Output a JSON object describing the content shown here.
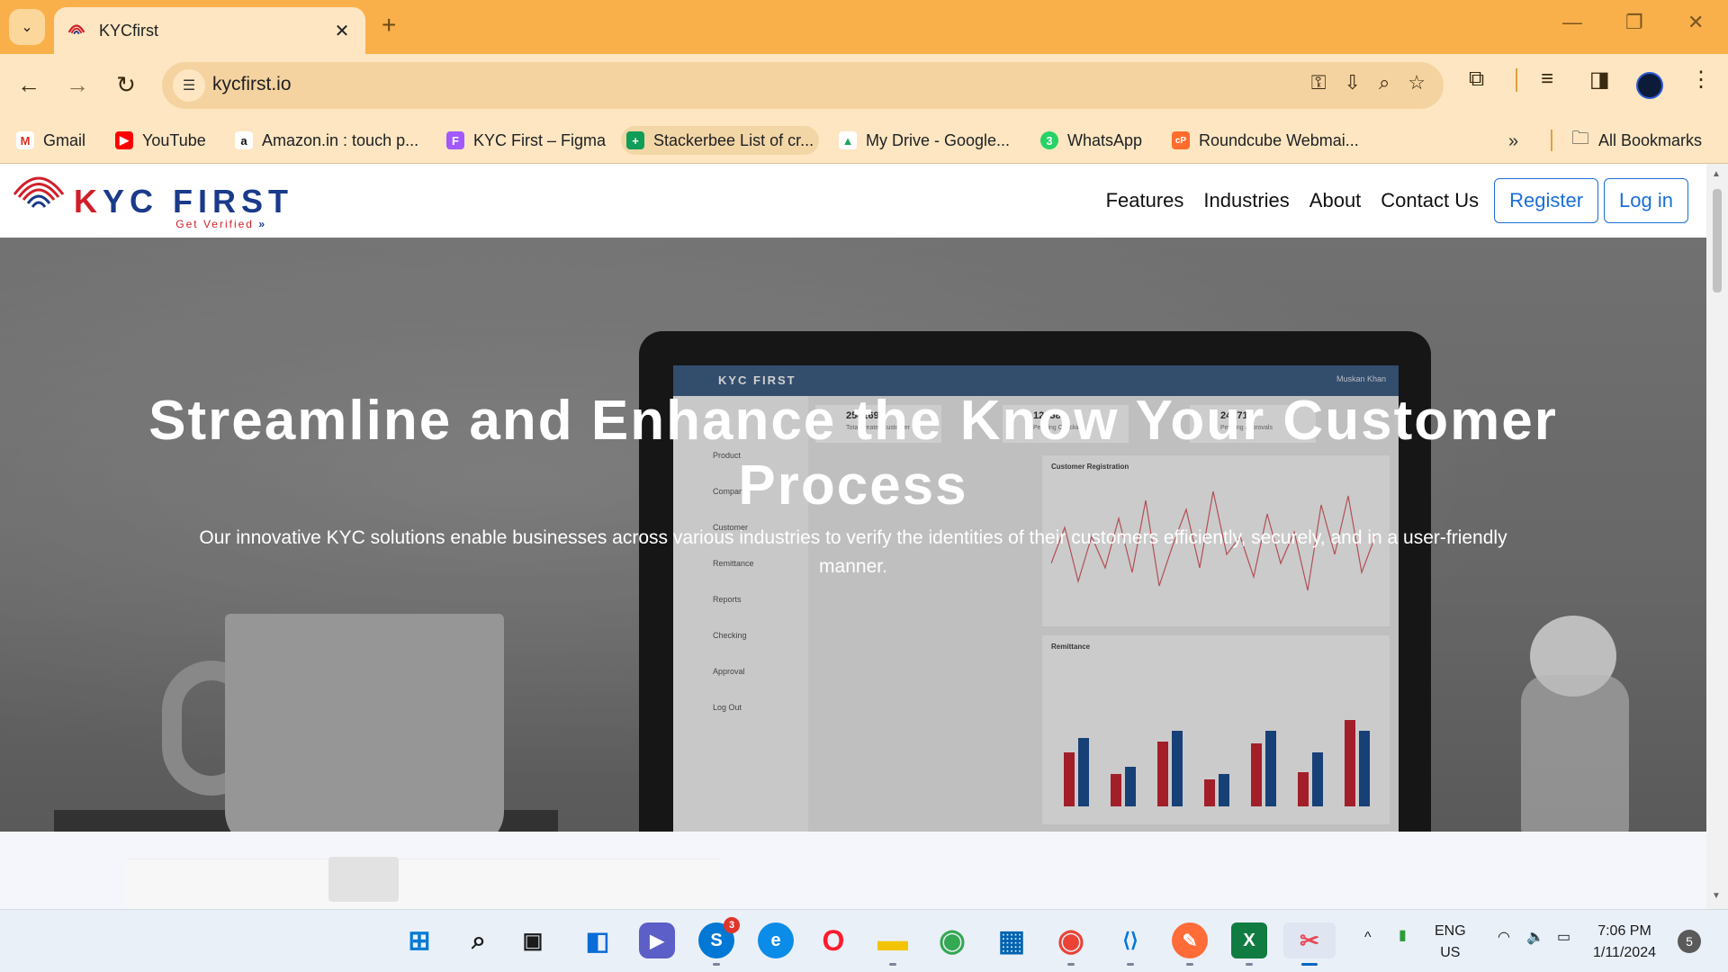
{
  "browser": {
    "tab": {
      "title": "KYCfirst",
      "close": "✕"
    },
    "new_tab": "+",
    "window_controls": {
      "minimize": "—",
      "maximize": "❐",
      "close": "✕"
    },
    "nav": {
      "back": "←",
      "forward": "→",
      "reload": "↻"
    },
    "url": "kycfirst.io",
    "bookmarks": [
      {
        "label": "Gmail",
        "icon": "gmail-icon",
        "color": "#d93025",
        "glyph": "M"
      },
      {
        "label": "YouTube",
        "icon": "youtube-icon",
        "color": "#ff0000",
        "glyph": "▶"
      },
      {
        "label": "Amazon.in : touch p...",
        "icon": "amazon-icon",
        "color": "#111111",
        "glyph": "a"
      },
      {
        "label": "KYC First – Figma",
        "icon": "figma-icon",
        "color": "#a259ff",
        "glyph": "F"
      },
      {
        "label": "Stackerbee List of cr...",
        "icon": "sheets-icon",
        "color": "#0f9d58",
        "glyph": "+"
      },
      {
        "label": "My Drive - Google...",
        "icon": "drive-icon",
        "color": "#1fa463",
        "glyph": "▲"
      },
      {
        "label": "WhatsApp",
        "icon": "whatsapp-icon",
        "color": "#25d366",
        "glyph": "3"
      },
      {
        "label": "Roundcube Webmai...",
        "icon": "cpanel-icon",
        "color": "#ff6c2c",
        "glyph": "cP"
      }
    ],
    "more_bookmarks": "»",
    "all_bookmarks": "All Bookmarks"
  },
  "site": {
    "logo": {
      "word_k": "K",
      "word_rest": "YC FIRST",
      "tagline": "Get Verified"
    },
    "nav": [
      "Features",
      "Industries",
      "About",
      "Contact Us"
    ],
    "register": "Register",
    "login": "Log in",
    "hero": {
      "title": "Streamline and Enhance the Know Your Customer Process",
      "subtitle": "Our innovative KYC solutions enable businesses across various industries to verify the identities of their customers efficiently, securely, and in a user-friendly manner."
    },
    "mockup": {
      "brand": "KYC FIRST",
      "user": "Muskan Khan",
      "stats": [
        {
          "value": "254169",
          "label": "Total created customer"
        },
        {
          "value": "12458",
          "label": "Pending Checking"
        },
        {
          "value": "241711",
          "label": "Pending approvals"
        }
      ],
      "menu": [
        "Product",
        "Company",
        "Customer",
        "Remittance",
        "Reports",
        "Checking",
        "Approval",
        "Log Out"
      ],
      "chart1_title": "Customer Registration",
      "chart2_title": "Remittance"
    }
  },
  "taskbar": {
    "apps": [
      {
        "name": "start-button",
        "glyph": "⊞",
        "color": "#0078d4"
      },
      {
        "name": "search-button",
        "glyph": "⌕",
        "color": "#1b1b1b"
      },
      {
        "name": "task-view-button",
        "glyph": "▣",
        "color": "#1b1b1b"
      },
      {
        "name": "widgets-button",
        "glyph": "◧",
        "color": "#0a6cd6"
      },
      {
        "name": "teams-app",
        "glyph": "▶",
        "color": "#5b5fc7"
      },
      {
        "name": "skype-app",
        "glyph": "S",
        "color": "#0078d4",
        "badge": "3"
      },
      {
        "name": "edge-app",
        "glyph": "e",
        "color": "#0c8ce9"
      },
      {
        "name": "opera-app",
        "glyph": "O",
        "color": "#ff1b2d"
      },
      {
        "name": "file-explorer-app",
        "glyph": "▬",
        "color": "#f3c400"
      },
      {
        "name": "chrome-app",
        "glyph": "◉",
        "color": "#34a853"
      },
      {
        "name": "store-app",
        "glyph": "▦",
        "color": "#0063b1"
      },
      {
        "name": "chrome-profile-app",
        "glyph": "◉",
        "color": "#ea4335"
      },
      {
        "name": "vscode-app",
        "glyph": "⟨⟩",
        "color": "#0078d4"
      },
      {
        "name": "postman-app",
        "glyph": "✎",
        "color": "#ff6c37"
      },
      {
        "name": "excel-app",
        "glyph": "X",
        "color": "#107c41"
      },
      {
        "name": "snipping-tool-app",
        "glyph": "✂",
        "color": "#e74856"
      }
    ],
    "tray": {
      "chevron": "^",
      "lang_line1": "ENG",
      "lang_line2": "US",
      "wifi": "◠",
      "volume": "🔈",
      "battery": "▭"
    },
    "time": "7:06 PM",
    "date": "1/11/2024",
    "notification_count": "5"
  }
}
